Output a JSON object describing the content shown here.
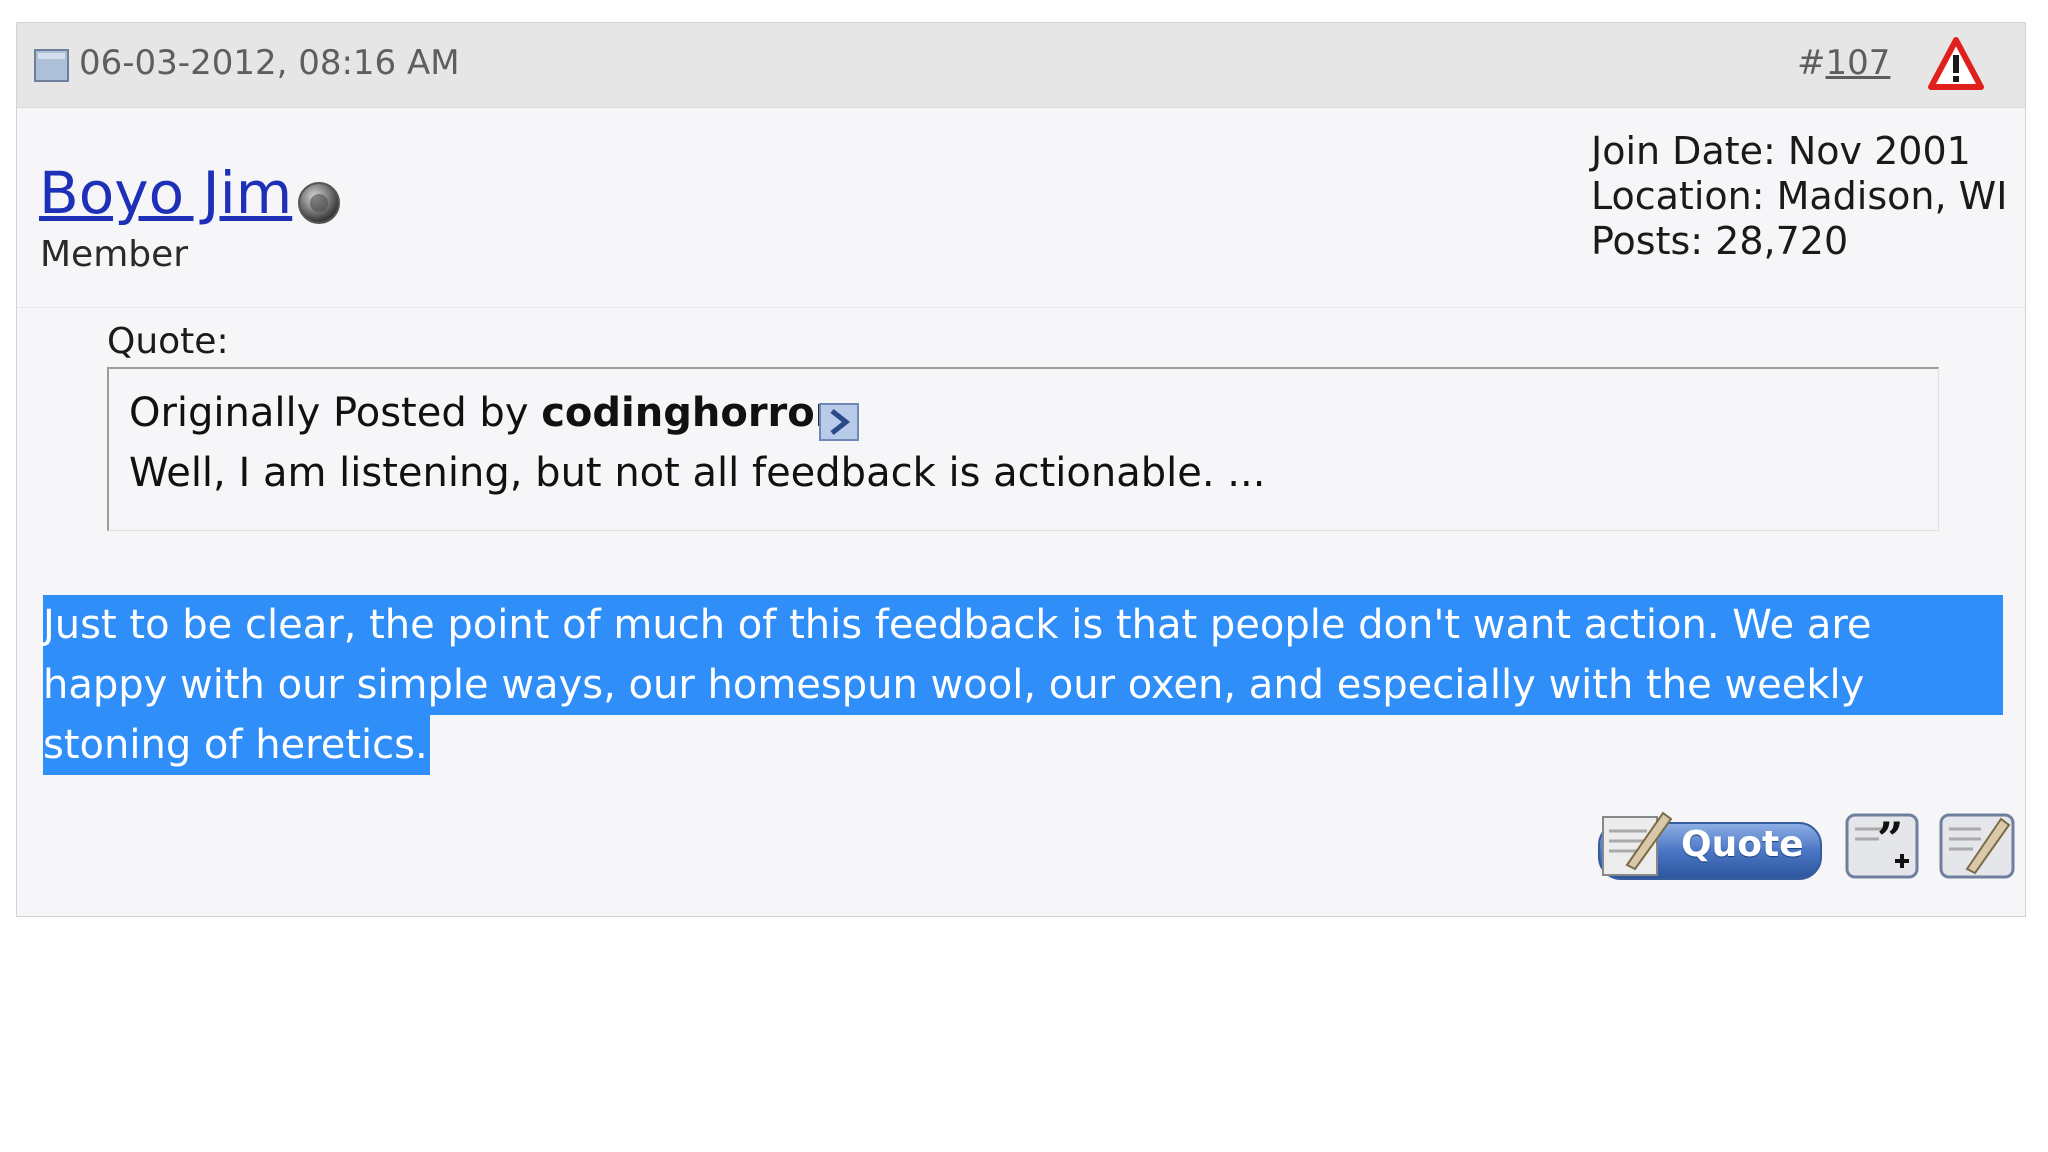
{
  "post": {
    "date": "06-03-2012, 08:16 AM",
    "number_prefix": "#",
    "number": "107"
  },
  "user": {
    "name": "Boyo Jim",
    "title": "Member",
    "join_date": "Join Date: Nov 2001",
    "location": "Location: Madison, WI",
    "posts": "Posts: 28,720"
  },
  "quote": {
    "label": "Quote:",
    "originally_posted_by": "Originally Posted by",
    "author": "codinghorror",
    "text": "Well, I am listening, but not all feedback is actionable. ..."
  },
  "message": {
    "line1": "Just to be clear, the point of much of this feedback is that people don't want action. We are",
    "line2": "happy with our simple ways, our homespun wool, our oxen, and especially with the weekly",
    "line3": "stoning of heretics."
  },
  "buttons": {
    "quote_label": "Quote"
  },
  "colors": {
    "selection": "#2f8ef8",
    "username": "#1e2fb8",
    "header_bg": "#e6e6e6",
    "report_red": "#e0201c"
  },
  "icons": {
    "post": "post-icon",
    "report": "report-warning-icon",
    "status": "offline-status-icon",
    "view_post": "view-post-arrow-icon",
    "multiquote": "multiquote-icon",
    "reply": "reply-icon"
  }
}
